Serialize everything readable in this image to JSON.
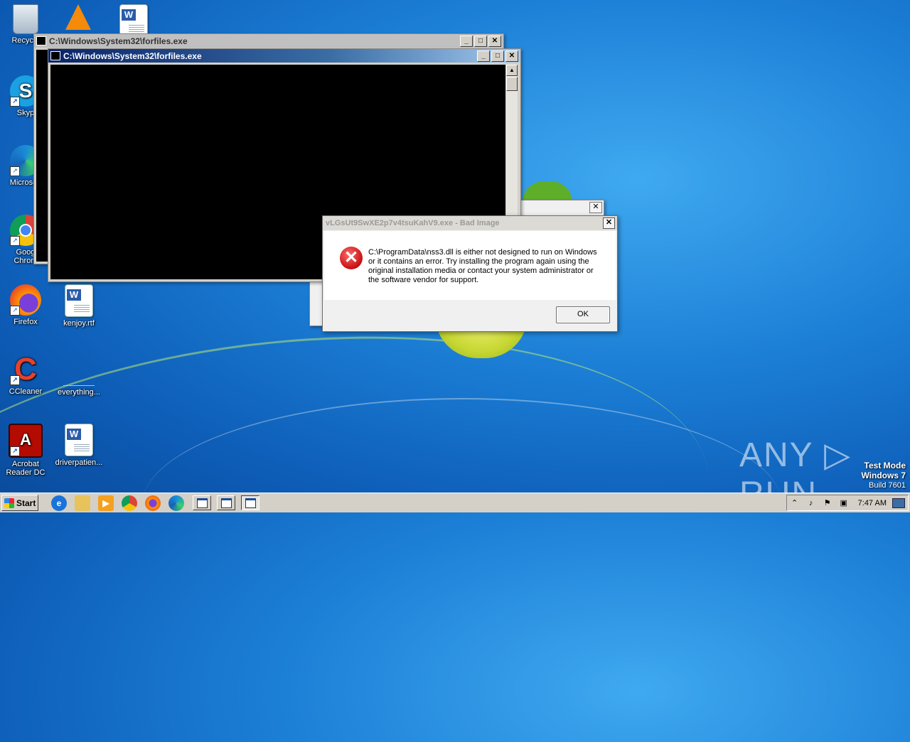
{
  "desktop": {
    "icons": [
      {
        "label": "Recycle",
        "icon": "recycle-bin-icon"
      },
      {
        "label": "",
        "icon": "vlc-icon"
      },
      {
        "label": "",
        "icon": "word-doc-icon"
      },
      {
        "label": "Skyp",
        "icon": "skype-icon"
      },
      {
        "label": "Microsoft",
        "icon": "edge-icon"
      },
      {
        "label": "Goog\nChrom",
        "icon": "chrome-icon"
      },
      {
        "label": "Firefox",
        "icon": "firefox-icon"
      },
      {
        "label": "kenjoy.rtf",
        "icon": "word-doc-icon"
      },
      {
        "label": "CCleaner",
        "icon": "ccleaner-icon"
      },
      {
        "label": "everything...",
        "icon": "blank-file-icon"
      },
      {
        "label": "Acrobat\nReader DC",
        "icon": "acrobat-icon"
      },
      {
        "label": "driverpatien...",
        "icon": "word-doc-icon"
      }
    ]
  },
  "windows": {
    "back_console_title": "C:\\Windows\\System32\\forfiles.exe",
    "front_console_title": "C:\\Windows\\System32\\forfiles.exe",
    "hidden_window_close": "✕"
  },
  "dialog": {
    "title": "vLGsUt9SwXE2p7v4tsuKahV9.exe - Bad Image",
    "message": "C:\\ProgramData\\nss3.dll is either not designed to run on Windows or it contains an error. Try installing the program again using the original installation media or contact your system administrator or the software vendor for support.",
    "ok_label": "OK",
    "icon": "error-icon"
  },
  "watermark": {
    "brand": "ANY ▷ RUN",
    "test_mode": "Test Mode",
    "os": "Windows 7",
    "build": "Build 7601"
  },
  "taskbar": {
    "start_label": "Start",
    "clock": "7:47 AM",
    "pinned": [
      "ie-icon",
      "explorer-icon",
      "media-player-icon",
      "chrome-icon",
      "firefox-icon",
      "edge-icon"
    ],
    "tray_icons": [
      "show-hidden-icon",
      "volume-icon",
      "action-center-flag-icon",
      "network-icon"
    ]
  }
}
